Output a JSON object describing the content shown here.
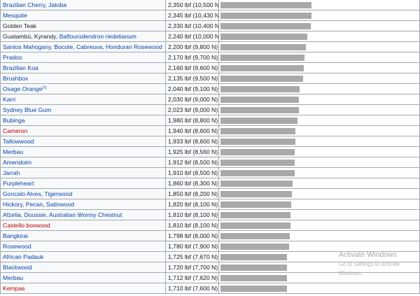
{
  "rows": [
    {
      "names": [
        {
          "text": "Brazilian Cherry, Jatoba",
          "color": "link"
        }
      ],
      "value": "2,350 lbf (10,500 N)",
      "lbf": 2350
    },
    {
      "names": [
        {
          "text": "Mesquite",
          "color": "link"
        }
      ],
      "value": "2,345 lbf (10,430 N)",
      "lbf": 2345
    },
    {
      "names": [
        {
          "text": "Golden Teak",
          "color": "plain"
        }
      ],
      "value": "2,330 lbf (10,400 N)",
      "lbf": 2330
    },
    {
      "names": [
        {
          "text": "Guatambú, Kyrandy, ",
          "color": "plain"
        },
        {
          "text": "Balfourodendron riedelianum",
          "color": "link"
        }
      ],
      "value": "2,240 lbf (10,000 N)",
      "lbf": 2240
    },
    {
      "names": [
        {
          "text": "Santos Mahogany, Bocote, Cabreuva, Honduran Rosewood",
          "color": "link"
        }
      ],
      "value": "2,200 lbf (9,800 N)",
      "lbf": 2200
    },
    {
      "names": [
        {
          "text": "Pradoo",
          "color": "link"
        }
      ],
      "value": "2,170 lbf (9,700 N)",
      "lbf": 2170
    },
    {
      "names": [
        {
          "text": "Brazilian Koa",
          "color": "link"
        }
      ],
      "value": "2,160 lbf (9,600 N)",
      "lbf": 2160
    },
    {
      "names": [
        {
          "text": "Brushbox",
          "color": "link"
        }
      ],
      "value": "2,135 lbf (9,500 N)",
      "lbf": 2135
    },
    {
      "names": [
        {
          "text": "Osage Orange",
          "color": "link"
        }
      ],
      "sup": "[7]",
      "value": "2,040 lbf (9,100 N)",
      "lbf": 2040
    },
    {
      "names": [
        {
          "text": "Karri",
          "color": "link"
        }
      ],
      "value": "2,030 lbf (9,000 N)",
      "lbf": 2030
    },
    {
      "names": [
        {
          "text": "Sydney Blue Gum",
          "color": "link"
        }
      ],
      "value": "2,023 lbf (9,000 N)",
      "lbf": 2023
    },
    {
      "names": [
        {
          "text": "Bubinga",
          "color": "link"
        }
      ],
      "value": "1,980 lbf (8,800 N)",
      "lbf": 1980
    },
    {
      "names": [
        {
          "text": "Cameron",
          "color": "red"
        }
      ],
      "value": "1,940 lbf (8,600 N)",
      "lbf": 1940
    },
    {
      "names": [
        {
          "text": "Tallowwood",
          "color": "link"
        }
      ],
      "value": "1,933 lbf (8,600 N)",
      "lbf": 1933
    },
    {
      "names": [
        {
          "text": "Merbau",
          "color": "link"
        }
      ],
      "value": "1,925 lbf (8,560 N)",
      "lbf": 1925
    },
    {
      "names": [
        {
          "text": "Amendoim",
          "color": "link"
        }
      ],
      "value": "1,912 lbf (8,500 N)",
      "lbf": 1912
    },
    {
      "names": [
        {
          "text": "Jarrah",
          "color": "link"
        }
      ],
      "value": "1,910 lbf (8,500 N)",
      "lbf": 1910
    },
    {
      "names": [
        {
          "text": "Purpleheart",
          "color": "link"
        }
      ],
      "value": "1,860 lbf (8,300 N)",
      "lbf": 1860
    },
    {
      "names": [
        {
          "text": "Goncalo Alves, Tigerwood",
          "color": "link"
        }
      ],
      "value": "1,850 lbf (8,200 N)",
      "lbf": 1850
    },
    {
      "names": [
        {
          "text": "Hickory, Pecan, Satinwood",
          "color": "link"
        }
      ],
      "value": "1,820 lbf (8,100 N)",
      "lbf": 1820
    },
    {
      "names": [
        {
          "text": "Afzelia, Doussie, Australian Wormy Chestnut",
          "color": "link"
        }
      ],
      "value": "1,810 lbf (8,100 N)",
      "lbf": 1810
    },
    {
      "names": [
        {
          "text": "Castello boxwood",
          "color": "red"
        }
      ],
      "value": "1,810 lbf (8,100 N)",
      "lbf": 1810
    },
    {
      "names": [
        {
          "text": "Bangkirai",
          "color": "link"
        }
      ],
      "value": "1,798 lbf (8,000 N)",
      "lbf": 1798
    },
    {
      "names": [
        {
          "text": "Rosewood",
          "color": "link"
        }
      ],
      "value": "1,780 lbf (7,900 N)",
      "lbf": 1780
    },
    {
      "names": [
        {
          "text": "African Padauk",
          "color": "link"
        }
      ],
      "value": "1,725 lbf (7,670 N)",
      "lbf": 1725
    },
    {
      "names": [
        {
          "text": "Blackwood",
          "color": "link"
        }
      ],
      "value": "1,720 lbf (7,700 N)",
      "lbf": 1720
    },
    {
      "names": [
        {
          "text": "Merbau",
          "color": "link"
        }
      ],
      "value": "1,712 lbf (7,620 N)",
      "lbf": 1712
    },
    {
      "names": [
        {
          "text": "Kempas",
          "color": "red"
        }
      ],
      "value": "1,710 lbf (7,600 N)",
      "lbf": 1710
    }
  ],
  "watermark": {
    "title": "Activate Windows",
    "subtitle": "Go to Settings to activate Windows."
  },
  "colors": {
    "link": "#0645ad",
    "redlink": "#ba0000",
    "bar": "#a9a9a9",
    "border": "#a2a9b1"
  }
}
